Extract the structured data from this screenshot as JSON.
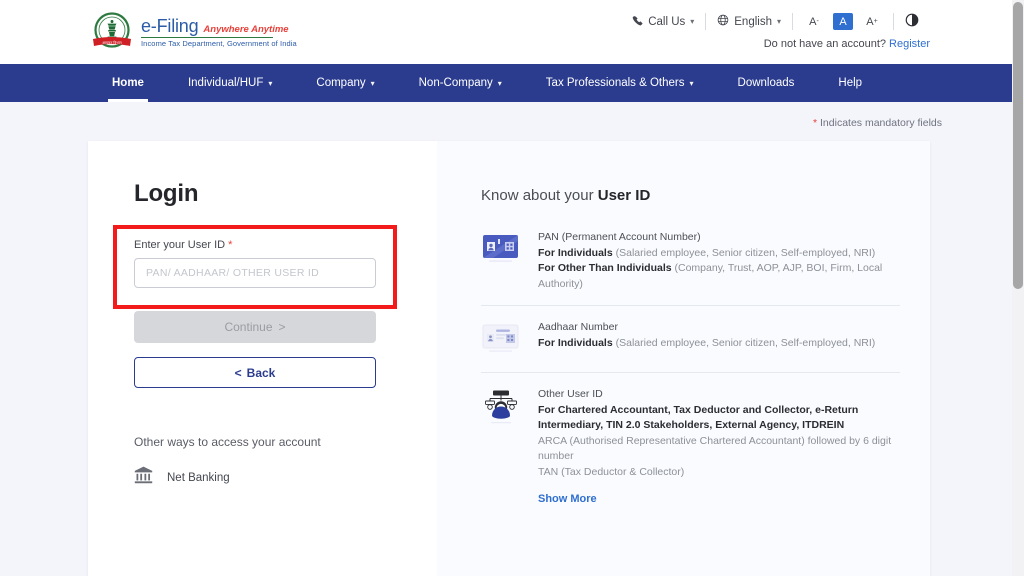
{
  "header": {
    "brand": {
      "name": "e-Filing",
      "tagline": "Anywhere Anytime",
      "subtitle": "Income Tax Department, Government of India",
      "emblem_icon": "india-emblem-icon"
    },
    "call_us": "Call Us",
    "call_us_icon": "phone-icon",
    "language": "English",
    "language_icon": "globe-icon",
    "font_decrease": "A",
    "font_normal": "A",
    "font_increase": "A",
    "font_decrease_sup": "-",
    "font_increase_sup": "+",
    "contrast_icon": "contrast-icon",
    "account_prompt": "Do not have an account?",
    "register": "Register"
  },
  "nav": {
    "items": [
      {
        "label": "Home",
        "has_caret": false,
        "active": true
      },
      {
        "label": "Individual/HUF",
        "has_caret": true,
        "active": false
      },
      {
        "label": "Company",
        "has_caret": true,
        "active": false
      },
      {
        "label": "Non-Company",
        "has_caret": true,
        "active": false
      },
      {
        "label": "Tax Professionals & Others",
        "has_caret": true,
        "active": false
      },
      {
        "label": "Downloads",
        "has_caret": false,
        "active": false
      },
      {
        "label": "Help",
        "has_caret": false,
        "active": false
      }
    ]
  },
  "mandatory_note": {
    "star": "*",
    "text": "Indicates mandatory fields"
  },
  "login": {
    "title": "Login",
    "userid_label": "Enter your User ID",
    "userid_required_star": "*",
    "userid_value": "",
    "userid_placeholder": "PAN/ AADHAAR/ OTHER USER ID",
    "continue_label": "Continue",
    "continue_chevron": ">",
    "back_chevron": "<",
    "back_label": "Back",
    "other_ways_label": "Other ways to access your account",
    "net_banking_label": "Net Banking",
    "net_banking_icon": "bank-icon"
  },
  "know": {
    "title_prefix": "Know about your",
    "title_strong": "User ID",
    "items": [
      {
        "icon": "pan-card-icon",
        "head": "PAN (Permanent Account Number)",
        "line2_bold": "For Individuals",
        "line2_rest": "(Salaried employee, Senior citizen, Self-employed, NRI)",
        "line3_bold": "For Other Than Individuals",
        "line3_rest": "(Company, Trust, AOP, AJP, BOI, Firm, Local Authority)"
      },
      {
        "icon": "aadhaar-card-icon",
        "head": "Aadhaar Number",
        "line2_bold": "For Individuals",
        "line2_rest": "(Salaried employee, Senior citizen, Self-employed, NRI)",
        "line3_bold": "",
        "line3_rest": ""
      },
      {
        "icon": "org-person-icon",
        "head": "Other User ID",
        "line2_bold": "For Chartered Accountant, Tax Deductor and Collector, e-Return Intermediary, TIN 2.0 Stakeholders, External Agency, ITDREIN",
        "line2_rest": "",
        "line3_bold": "",
        "line3_rest": "ARCA (Authorised Representative Chartered Accountant) followed by 6 digit number",
        "line4_rest": "TAN (Tax Deductor & Collector)",
        "show_more": "Show More"
      }
    ]
  },
  "colors": {
    "nav_navy": "#2b3c8f",
    "brand_blue": "#2c5ca8",
    "accent_red": "#e8413a",
    "highlight_red": "#f21a1a",
    "link_blue": "#2f6fd0",
    "page_bg": "#f4f5fb"
  }
}
